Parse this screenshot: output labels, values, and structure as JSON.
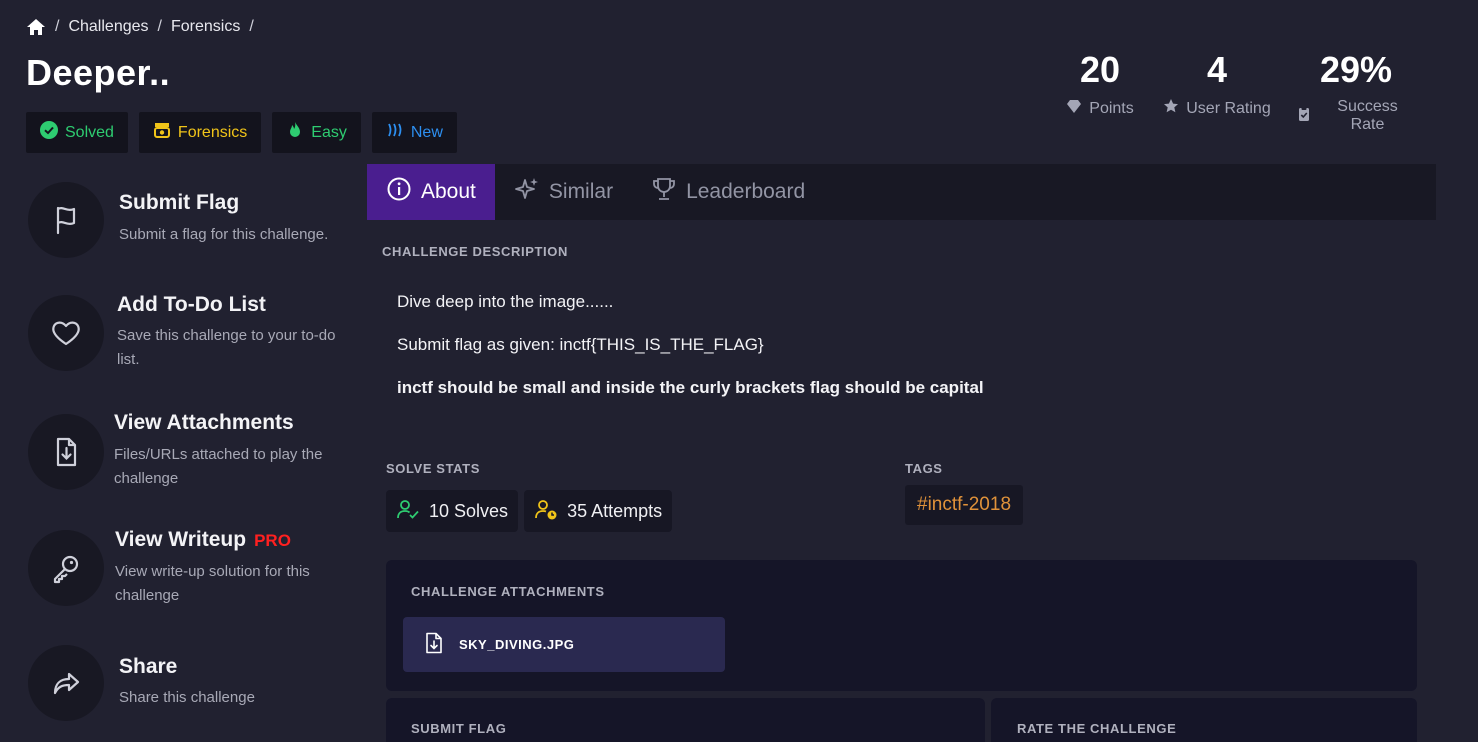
{
  "breadcrumb": {
    "items": [
      "Challenges",
      "Forensics"
    ],
    "separator": "/"
  },
  "title": "Deeper..",
  "badges": {
    "solved": "Solved",
    "category": "Forensics",
    "difficulty": "Easy",
    "status": "New"
  },
  "stats": {
    "points": {
      "value": "20",
      "label": "Points"
    },
    "rating": {
      "value": "4",
      "label": "User Rating"
    },
    "success": {
      "value": "29%",
      "label": "Success Rate"
    }
  },
  "sidebar": {
    "items": [
      {
        "title": "Submit Flag",
        "desc": "Submit a flag for this challenge."
      },
      {
        "title": "Add To-Do List",
        "desc": "Save this challenge to your to-do list."
      },
      {
        "title": "View Attachments",
        "desc": "Files/URLs attached to play the challenge"
      },
      {
        "title": "View Writeup",
        "badge": "PRO",
        "desc": "View write-up solution for this challenge"
      },
      {
        "title": "Share",
        "desc": "Share this challenge"
      }
    ]
  },
  "tabs": [
    {
      "label": "About",
      "active": true
    },
    {
      "label": "Similar",
      "active": false
    },
    {
      "label": "Leaderboard",
      "active": false
    }
  ],
  "description": {
    "heading": "CHALLENGE DESCRIPTION",
    "lines": [
      "Dive deep into the image......",
      "Submit flag as given: inctf{THIS_IS_THE_FLAG}",
      "inctf should be small and inside the curly brackets flag should be capital"
    ]
  },
  "solve_stats": {
    "heading": "SOLVE STATS",
    "solves": "10 Solves",
    "attempts": "35 Attempts"
  },
  "tags": {
    "heading": "TAGS",
    "items": [
      "#inctf-2018"
    ]
  },
  "attachments": {
    "heading": "CHALLENGE ATTACHMENTS",
    "files": [
      "SKY_DIVING.JPG"
    ]
  },
  "submit_panel": {
    "heading": "SUBMIT FLAG"
  },
  "rate_panel": {
    "heading": "RATE THE CHALLENGE"
  },
  "colors": {
    "background": "#212130",
    "accent_tab": "#4a1e8f",
    "success": "#2ecc71",
    "warning": "#f0c419",
    "info": "#2d8ff0",
    "pro": "#ff2020",
    "tag": "#e0923a"
  },
  "icons": {
    "home": "home-icon",
    "solved": "check-circle-icon",
    "category": "forensics-icon",
    "difficulty": "flame-icon",
    "status": "new-waves-icon",
    "points": "diamond-icon",
    "rating": "star-icon",
    "success": "clipboard-check-icon",
    "about": "info-icon",
    "similar": "sparkles-icon",
    "leaderboard": "trophy-icon"
  }
}
